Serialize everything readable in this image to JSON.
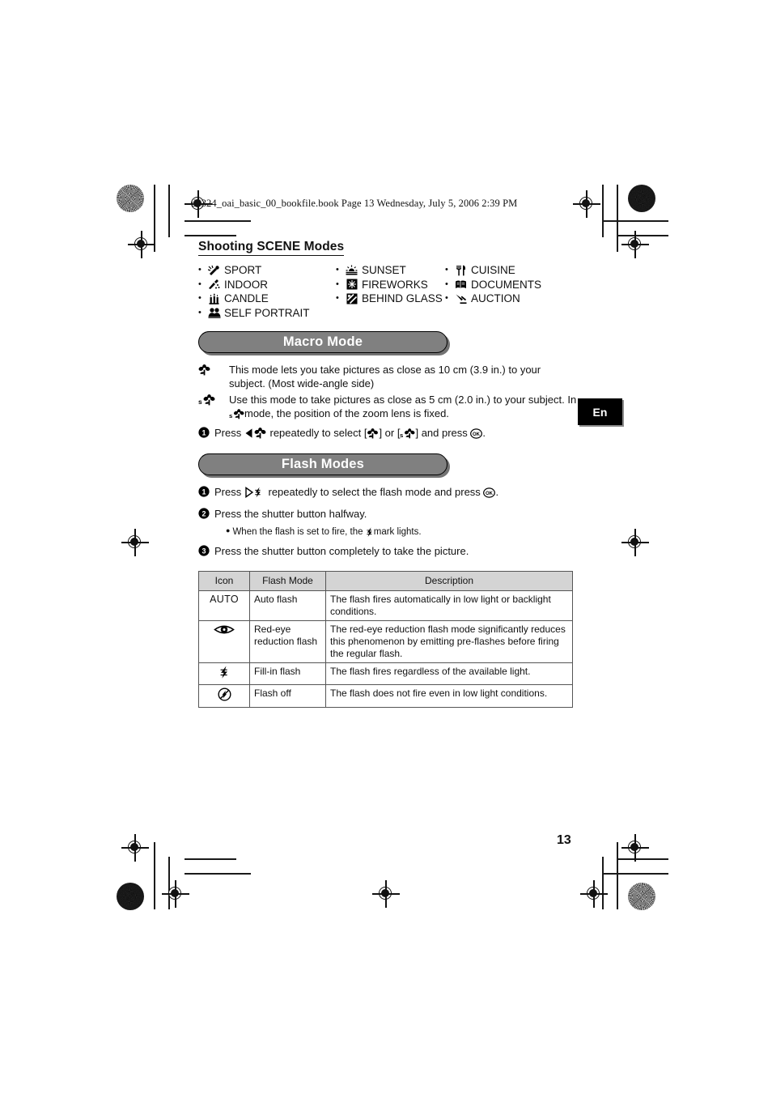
{
  "page": {
    "file_header": "d4324_oai_basic_00_bookfile.book  Page 13  Wednesday, July 5, 2006  2:39 PM",
    "page_number": "13",
    "language_tab": "En"
  },
  "scene_section": {
    "title": "Shooting SCENE Modes",
    "bullet": "•",
    "columns": [
      {
        "items": [
          {
            "icon": "sport-icon",
            "label": "SPORT"
          },
          {
            "icon": "indoor-icon",
            "label": "INDOOR"
          },
          {
            "icon": "candle-icon",
            "label": "CANDLE"
          },
          {
            "icon": "self-portrait-icon",
            "label": "SELF PORTRAIT"
          }
        ]
      },
      {
        "items": [
          {
            "icon": "sunset-icon",
            "label": "SUNSET"
          },
          {
            "icon": "fireworks-icon",
            "label": "FIREWORKS"
          },
          {
            "icon": "behind-glass-icon",
            "label": "BEHIND GLASS"
          }
        ]
      },
      {
        "items": [
          {
            "icon": "cuisine-icon",
            "label": "CUISINE"
          },
          {
            "icon": "documents-icon",
            "label": "DOCUMENTS"
          },
          {
            "icon": "auction-icon",
            "label": "AUCTION"
          }
        ]
      }
    ]
  },
  "macro_section": {
    "banner": "Macro Mode",
    "rows": [
      {
        "icon": "macro-flower-icon",
        "text": "This mode lets you take pictures as close as 10 cm (3.9 in.) to your subject. (Most wide-angle side)"
      },
      {
        "icon": "super-macro-flower-icon",
        "text_before": "Use this mode to take pictures as close as 5 cm (2.0 in.) to your subject. In",
        "text_after": "mode, the position of the zoom lens is fixed."
      }
    ],
    "step": {
      "number": "1",
      "part1": "Press",
      "part2": "repeatedly to select [",
      "part3": "] or [",
      "part4": "] and press",
      "part5": "."
    }
  },
  "flash_section": {
    "banner": "Flash Modes",
    "steps": [
      {
        "number": "1",
        "part1": "Press",
        "part2": "repeatedly to select the flash mode and press",
        "part3": "."
      },
      {
        "number": "2",
        "text": "Press the shutter button halfway.",
        "substep_before": "When the flash is set to fire, the",
        "substep_after": "mark lights."
      },
      {
        "number": "3",
        "text": "Press the shutter button completely to take the picture."
      }
    ],
    "table": {
      "headers": [
        "Icon",
        "Flash Mode",
        "Description"
      ],
      "rows": [
        {
          "icon_text": "AUTO",
          "icon_kind": "text",
          "mode": "Auto flash",
          "description": "The flash fires automatically in low light or backlight conditions."
        },
        {
          "icon_text": "",
          "icon_kind": "red-eye-icon",
          "mode": "Red-eye reduction flash",
          "description": "The red-eye reduction flash mode significantly reduces this phenomenon by emitting pre-flashes before firing the regular flash."
        },
        {
          "icon_text": "",
          "icon_kind": "flash-bolt-icon",
          "mode": "Fill-in flash",
          "description": "The flash fires regardless of the available light."
        },
        {
          "icon_text": "",
          "icon_kind": "flash-off-icon",
          "mode": "Flash off",
          "description": "The flash does not fire even in low light conditions."
        }
      ]
    }
  },
  "colors": {
    "banner_fill": "#808080",
    "banner_text": "#ffffff",
    "table_header_fill": "#d4d4d4",
    "tab_fill": "#000000"
  }
}
